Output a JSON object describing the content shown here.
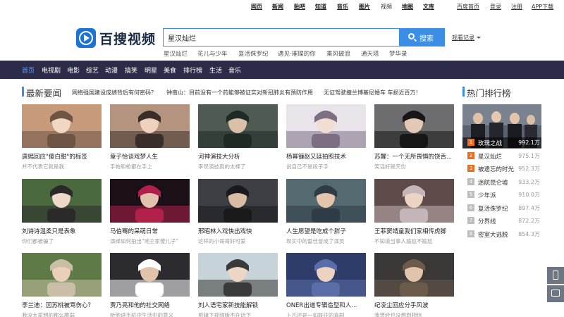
{
  "toplinks": [
    "网页",
    "新闻",
    "贴吧",
    "知道",
    "音乐",
    "图片",
    "视频",
    "地图",
    "文库"
  ],
  "userlinks": [
    "百度首页",
    "登录",
    "注册",
    "APP下载"
  ],
  "logo": {
    "text": "百搜视频",
    "icon": "play-icon"
  },
  "search": {
    "value": "星汉灿烂",
    "button": "搜索",
    "icon": "search-icon"
  },
  "history": "观看记录",
  "hotwords": [
    "星汉灿烂",
    "花儿与少年",
    "复活侏罗纪",
    "遇见·璀璨的你",
    "乘风破浪",
    "通天塔",
    "梦华录"
  ],
  "nav": [
    "首页",
    "电视剧",
    "电影",
    "综艺",
    "动漫",
    "搞笑",
    "明星",
    "美食",
    "排行榜",
    "生活",
    "音乐"
  ],
  "news": {
    "title": "最新要闻",
    "headlines": [
      "网络强国建设成绩背后有何密码？",
      "钟南山：目前没有一个药能够被证实对新冠肺炎有预防作用",
      "无证驾驶撞兰博基尼婚车 车损近百万！"
    ]
  },
  "cards": [
    {
      "title": "唐嫣回应\"傻白甜\"的标签",
      "sub": "并不代表它就是我"
    },
    {
      "title": "章子怡谈戏梦人生",
      "sub": "手帕和枪都在手上"
    },
    {
      "title": "河神演技大分析",
      "sub": "李现演技真的太棒了"
    },
    {
      "title": "杨幂镰赵又廷拍照技术",
      "sub": "说自己不是段子手"
    },
    {
      "title": "苏醒：一个无所畏惧的饶舌...",
      "sub": "笑话好是天份"
    },
    {
      "title": "刘诗诗温柔只是表象",
      "sub": "你们都被骗了"
    },
    {
      "title": "马伯骞的呆萌日常",
      "sub": "演绎如何拍出\"地主家傻儿子\""
    },
    {
      "title": "邢昭林入戏快出戏快",
      "sub": "这样的小哥哥好可爱"
    },
    {
      "title": "人生愿望是吃成个胖子",
      "sub": "现实中的雷佳音成了演员"
    },
    {
      "title": "王菲窦靖童我们家相传虎脚",
      "sub": "不知道当事人尴尬不尴尬"
    },
    {
      "title": "李兰迪：因苏桃被骂伤心？",
      "sub": "我没大家想的那么脆弱"
    },
    {
      "title": "贾乃亮和他的社交网络",
      "sub": "听他讲手机中生活中的意义"
    },
    {
      "title": "刘人语宅家新技能解锁",
      "sub": "剪辑下视频版不在话下"
    },
    {
      "title": "ONER出道专辑造型和人...",
      "sub": "卜凡还是一如既往的喜剧"
    },
    {
      "title": "纪凌尘回应分手风波",
      "sub": "我曾经也没想到相信"
    },
    {
      "title": "张嘉倪包里的东东也是高颜值",
      "sub": "我为了控制身材做了很多"
    }
  ],
  "rank": {
    "title": "热门排行榜",
    "items": [
      {
        "no": "1",
        "name": "玫瑰之战",
        "score": "992.1万"
      },
      {
        "no": "2",
        "name": "星汉灿烂",
        "score": "975.1万"
      },
      {
        "no": "3",
        "name": "被遗忘的时光",
        "score": "952.3万"
      },
      {
        "no": "4",
        "name": "迷航昆仑墟",
        "score": "933.2万"
      },
      {
        "no": "5",
        "name": "少年派",
        "score": "910.0万"
      },
      {
        "no": "6",
        "name": "复活侏罗纪",
        "score": "897.4万"
      },
      {
        "no": "7",
        "name": "分界线",
        "score": "872.2万"
      },
      {
        "no": "8",
        "name": "密室大逃脱",
        "score": "854.3万"
      }
    ]
  },
  "colors": {
    "accent": "#3b8ee6",
    "nav_bg": "#2c2c4a",
    "rank_top": "#ef6c1a",
    "rank_other": "#bdbdbd"
  }
}
